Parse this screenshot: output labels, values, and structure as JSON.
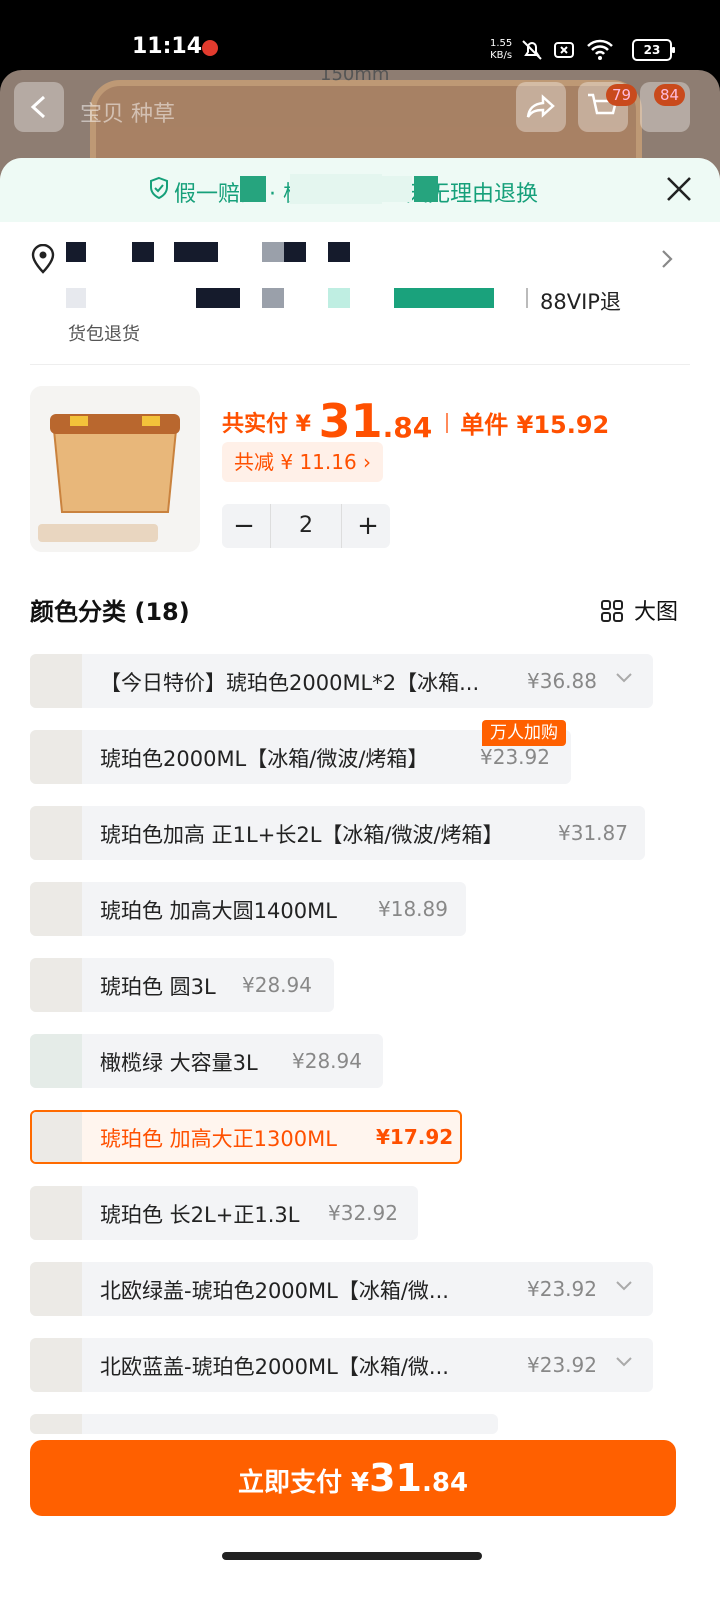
{
  "status_bar": {
    "time": "11:14",
    "speed_value": "1.55",
    "speed_unit": "KB/s",
    "battery": "23"
  },
  "behind_page": {
    "ruler": "150mm",
    "tabs": "宝贝 种草",
    "cart_badge": "79",
    "msg_badge": "84"
  },
  "guarantee": {
    "text": "假一赔四 · 极速退款 · 7天无理由退换"
  },
  "address": {
    "vip_text": "88VIP退",
    "cut_text": "货包退货"
  },
  "summary": {
    "paid_label": "共实付 ¥ ",
    "paid_int": "31",
    "paid_dec": ".84",
    "unit_label": "单件 ¥15.92",
    "discount": "共减 ¥ 11.16 ›",
    "quantity": "2",
    "minus": "−",
    "plus": "+"
  },
  "section": {
    "title": "颜色分类 (18)",
    "big_view": "大图"
  },
  "hot_tag": "万人加购",
  "options": [
    {
      "name": "【今日特价】琥珀色2000ML*2【冰箱...",
      "price": "¥36.88"
    },
    {
      "name": "琥珀色2000ML【冰箱/微波/烤箱】",
      "price": "¥23.92"
    },
    {
      "name": "琥珀色加高 正1L+长2L【冰箱/微波/烤箱】",
      "price": "¥31.87"
    },
    {
      "name": "琥珀色 加高大圆1400ML",
      "price": "¥18.89"
    },
    {
      "name": "琥珀色 圆3L",
      "price": "¥28.94"
    },
    {
      "name": "橄榄绿 大容量3L",
      "price": "¥28.94"
    },
    {
      "name": "琥珀色 加高大正1300ML",
      "price": "¥17.92"
    },
    {
      "name": "琥珀色 长2L+正1.3L",
      "price": "¥32.92"
    },
    {
      "name": "北欧绿盖-琥珀色2000ML【冰箱/微...",
      "price": "¥23.92"
    },
    {
      "name": "北欧蓝盖-琥珀色2000ML【冰箱/微...",
      "price": "¥23.92"
    }
  ],
  "pay": {
    "label": "立即支付 ¥",
    "int": "31",
    "dec": ".84"
  },
  "colors": {
    "accent": "#ff6000",
    "green": "#16a07a"
  }
}
